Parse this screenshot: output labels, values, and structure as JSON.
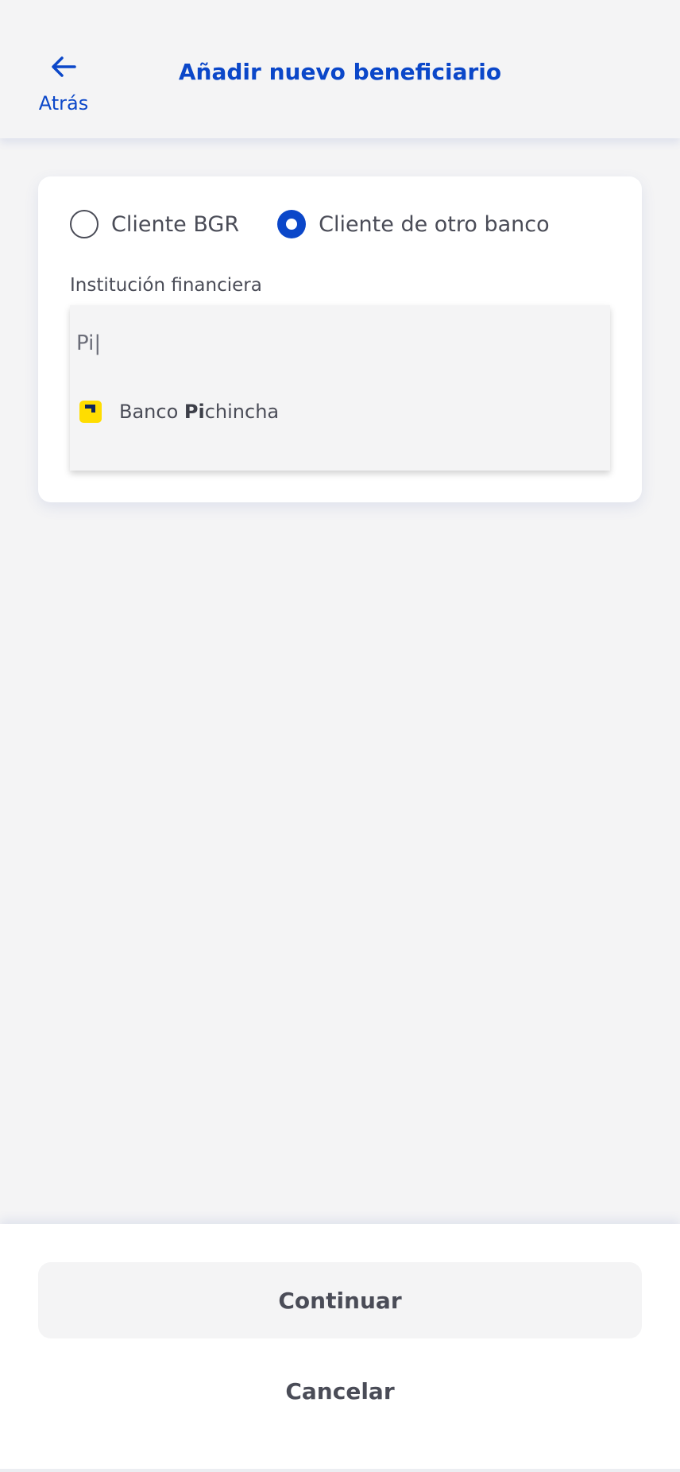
{
  "header": {
    "title": "Añadir nuevo beneficiario",
    "back_label": "Atrás",
    "back_icon": "arrow-left-icon"
  },
  "form": {
    "radio_options": [
      {
        "label": "Cliente BGR",
        "selected": false
      },
      {
        "label": "Cliente de otro banco",
        "selected": true
      }
    ],
    "field_label": "Institución financiera",
    "search_value": "Pi|",
    "results": [
      {
        "label_prefix": "Banco ",
        "label_match": "Pi",
        "label_rest": "chincha",
        "icon": "banco-pichincha-logo"
      }
    ]
  },
  "footer": {
    "continue_label": "Continuar",
    "cancel_label": "Cancelar"
  },
  "colors": {
    "accent": "#0b47c9",
    "background": "#f4f4f5",
    "text": "#4a4c57",
    "logo_yellow": "#ffdd00",
    "logo_dark": "#0f265c"
  }
}
